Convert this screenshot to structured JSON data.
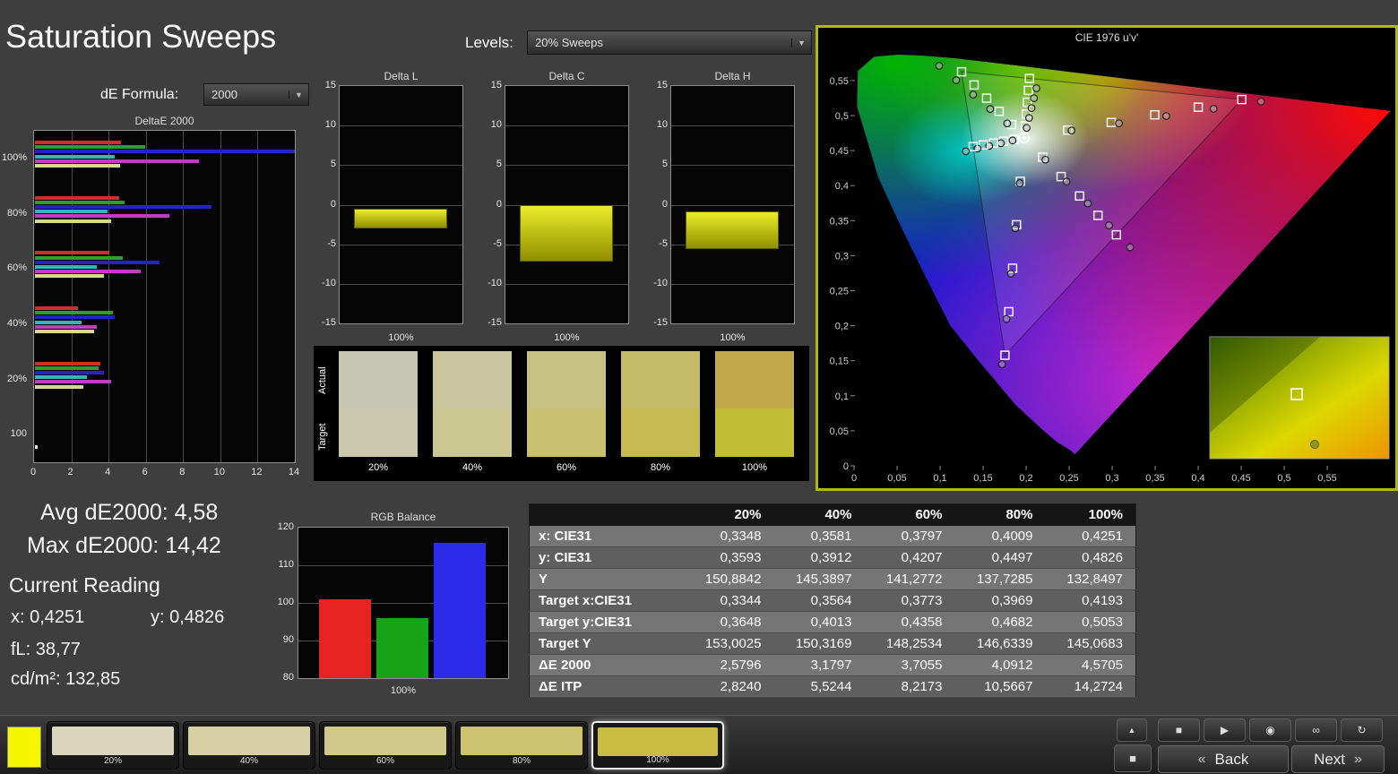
{
  "app": {
    "title": "Saturation Sweeps",
    "bg": "#3e3e3e"
  },
  "controls": {
    "levels_label": "Levels:",
    "levels_value": "20% Sweeps",
    "de_formula_label": "dE Formula:",
    "de_formula_value": "2000"
  },
  "stats": {
    "avg_de": "Avg dE2000: 4,58",
    "max_de": "Max dE2000: 14,42",
    "current_reading_label": "Current Reading",
    "x_value": "x: 0,4251",
    "y_value": "y: 0,4826",
    "fl_value": "fL: 38,77",
    "cdm2_value": "cd/m²: 132,85"
  },
  "chart_data": [
    {
      "id": "deltae2000",
      "type": "bar",
      "orientation": "horizontal",
      "title": "DeltaE 2000",
      "categories": [
        "100%",
        "80%",
        "60%",
        "40%",
        "20%",
        "100"
      ],
      "series": [
        {
          "name": "Red",
          "color": "#d22c2c",
          "values": [
            4.6,
            4.5,
            4.0,
            2.3,
            3.5,
            0
          ]
        },
        {
          "name": "Green",
          "color": "#2ca02c",
          "values": [
            5.9,
            4.8,
            4.7,
            4.2,
            3.4,
            0
          ]
        },
        {
          "name": "Blue",
          "color": "#2323c8",
          "values": [
            14.42,
            9.5,
            6.7,
            4.3,
            3.7,
            0
          ]
        },
        {
          "name": "Cyan",
          "color": "#30b8b8",
          "values": [
            4.3,
            3.9,
            3.3,
            2.5,
            2.8,
            0
          ]
        },
        {
          "name": "Magenta",
          "color": "#c23cc2",
          "values": [
            8.8,
            7.2,
            5.7,
            3.3,
            4.1,
            0
          ]
        },
        {
          "name": "Yellow",
          "color": "#d8d890",
          "values": [
            4.57,
            4.09,
            3.71,
            3.18,
            2.58,
            0
          ]
        },
        {
          "name": "White",
          "color": "#f0f0f0",
          "values": [
            0,
            0,
            0,
            0,
            0,
            0.15
          ]
        }
      ],
      "xlim": [
        0,
        14
      ],
      "xticks": [
        0,
        2,
        4,
        6,
        8,
        10,
        12,
        14
      ]
    },
    {
      "id": "delta_l",
      "type": "bar",
      "title": "Delta L",
      "ylim": [
        -15,
        15
      ],
      "yticks": [
        15,
        10,
        5,
        0,
        -5,
        -10,
        -15
      ],
      "bar": {
        "from": -0.5,
        "to": -3.0
      },
      "xlabel": "100%"
    },
    {
      "id": "delta_c",
      "type": "bar",
      "title": "Delta C",
      "ylim": [
        -15,
        15
      ],
      "yticks": [
        15,
        10,
        5,
        0,
        -5,
        -10,
        -15
      ],
      "bar": {
        "from": 0,
        "to": -7.2
      },
      "xlabel": "100%"
    },
    {
      "id": "delta_h",
      "type": "bar",
      "title": "Delta H",
      "ylim": [
        -15,
        15
      ],
      "yticks": [
        15,
        10,
        5,
        0,
        -5,
        -10,
        -15
      ],
      "bar": {
        "from": -0.8,
        "to": -5.6
      },
      "xlabel": "100%"
    },
    {
      "id": "rgb_balance",
      "type": "bar",
      "title": "RGB Balance",
      "categories": [
        "Red",
        "Green",
        "Blue"
      ],
      "values": [
        101,
        96,
        116
      ],
      "colors": [
        "#e62222",
        "#17a317",
        "#2b2be8"
      ],
      "ylim": [
        80,
        120
      ],
      "yticks": [
        120,
        110,
        100,
        90,
        80
      ],
      "xlabel": "100%"
    },
    {
      "id": "cie_diagram",
      "type": "scatter",
      "title": "CIE 1976 u'v'",
      "xlim": [
        0,
        0.55
      ],
      "ylim": [
        0,
        0.55
      ],
      "tick_step": 0.05,
      "white_point": [
        0.1978,
        0.4683
      ],
      "sweep_levels": [
        0.2,
        0.4,
        0.6,
        0.8,
        1.0
      ],
      "target_primaries": {
        "red": [
          0.4507,
          0.5229
        ],
        "green": [
          0.125,
          0.5625
        ],
        "blue": [
          0.1754,
          0.1579
        ],
        "cyan": [
          0.1385,
          0.4557
        ],
        "magenta": [
          0.305,
          0.3298
        ],
        "yellow": [
          0.2039,
          0.5529
        ]
      },
      "measured_primaries": {
        "red": [
          0.473,
          0.52
        ],
        "green": [
          0.099,
          0.571
        ],
        "blue": [
          0.172,
          0.145
        ],
        "cyan": [
          0.13,
          0.449
        ],
        "magenta": [
          0.321,
          0.312
        ],
        "yellow": [
          0.212,
          0.539
        ]
      }
    }
  ],
  "swatch_strip": {
    "row_labels": [
      "Actual",
      "Target"
    ],
    "levels": [
      "20%",
      "40%",
      "60%",
      "80%",
      "100%"
    ],
    "actual_colors": [
      "#c8c7b4",
      "#cac7a0",
      "#c8c287",
      "#c5ba66",
      "#bfa94a"
    ],
    "target_colors": [
      "#cac9ad",
      "#ccc892",
      "#c9c170",
      "#c7ba4e",
      "#c3bd32"
    ]
  },
  "measurement_table": {
    "columns": [
      "20%",
      "40%",
      "60%",
      "80%",
      "100%"
    ],
    "rows": [
      {
        "label": "x: CIE31",
        "values": [
          "0,3348",
          "0,3581",
          "0,3797",
          "0,4009",
          "0,4251"
        ]
      },
      {
        "label": "y: CIE31",
        "values": [
          "0,3593",
          "0,3912",
          "0,4207",
          "0,4497",
          "0,4826"
        ]
      },
      {
        "label": "Y",
        "values": [
          "150,8842",
          "145,3897",
          "141,2772",
          "137,7285",
          "132,8497"
        ]
      },
      {
        "label": "Target x:CIE31",
        "values": [
          "0,3344",
          "0,3564",
          "0,3773",
          "0,3969",
          "0,4193"
        ]
      },
      {
        "label": "Target y:CIE31",
        "values": [
          "0,3648",
          "0,4013",
          "0,4358",
          "0,4682",
          "0,5053"
        ]
      },
      {
        "label": "Target Y",
        "values": [
          "153,0025",
          "150,3169",
          "148,2534",
          "146,6339",
          "145,0683"
        ]
      },
      {
        "label": "ΔE 2000",
        "values": [
          "2,5796",
          "3,1797",
          "3,7055",
          "4,0912",
          "4,5705"
        ]
      },
      {
        "label": "ΔE ITP",
        "values": [
          "2,8240",
          "5,5244",
          "8,2173",
          "10,5667",
          "14,2724"
        ]
      }
    ]
  },
  "toolbar": {
    "active_swatch_color": "#f6f600",
    "patches": [
      {
        "label": "20%",
        "color": "#d9d6bd"
      },
      {
        "label": "40%",
        "color": "#d6d0a4"
      },
      {
        "label": "60%",
        "color": "#d2ca8c"
      },
      {
        "label": "80%",
        "color": "#cdc36e"
      },
      {
        "label": "100%",
        "color": "#c8bc42"
      }
    ],
    "selected_patch": "100%",
    "collapse_glyph": "▲",
    "patch_window_glyph": "■",
    "transport": [
      {
        "name": "stop",
        "glyph": "■"
      },
      {
        "name": "play",
        "glyph": "▶"
      },
      {
        "name": "measure",
        "glyph": "◉"
      },
      {
        "name": "continuous",
        "glyph": "∞"
      },
      {
        "name": "refresh",
        "glyph": "↻"
      }
    ],
    "back_chevron": "«",
    "back_label": "Back",
    "next_label": "Next",
    "next_chevron": "»"
  }
}
